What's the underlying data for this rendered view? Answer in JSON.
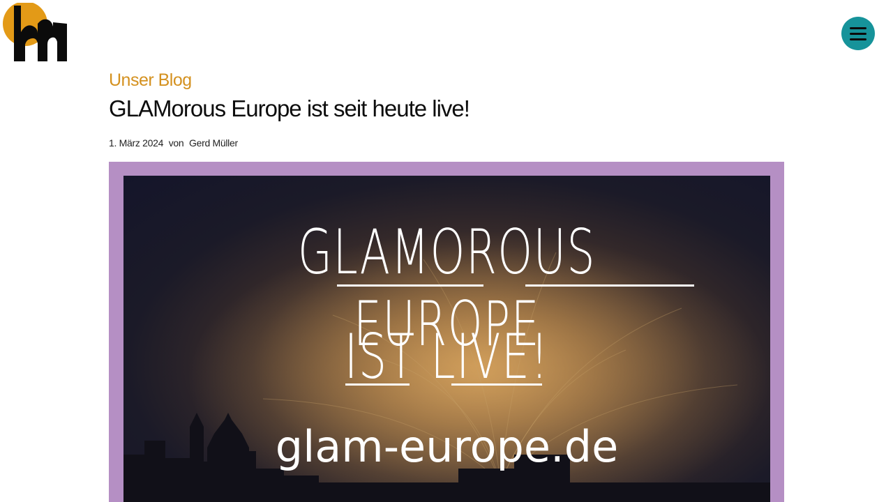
{
  "header": {
    "logo_icon": "brand-logo-icon",
    "menu_icon": "hamburger-menu-icon",
    "accent_color": "#16939a"
  },
  "post": {
    "category": "Unser Blog",
    "title": "GLAMorous Europe ist seit heute live!",
    "date": "1. März 2024",
    "by": "von",
    "author": "Gerd Müller"
  },
  "hero": {
    "line1": "GLAMOROUS EUROPE",
    "line2": "IST LIVE!",
    "url": "glam-europe.de",
    "frame_color": "#b58fc4"
  },
  "colors": {
    "category": "#d4911f",
    "logo_circle": "#e39a17"
  }
}
